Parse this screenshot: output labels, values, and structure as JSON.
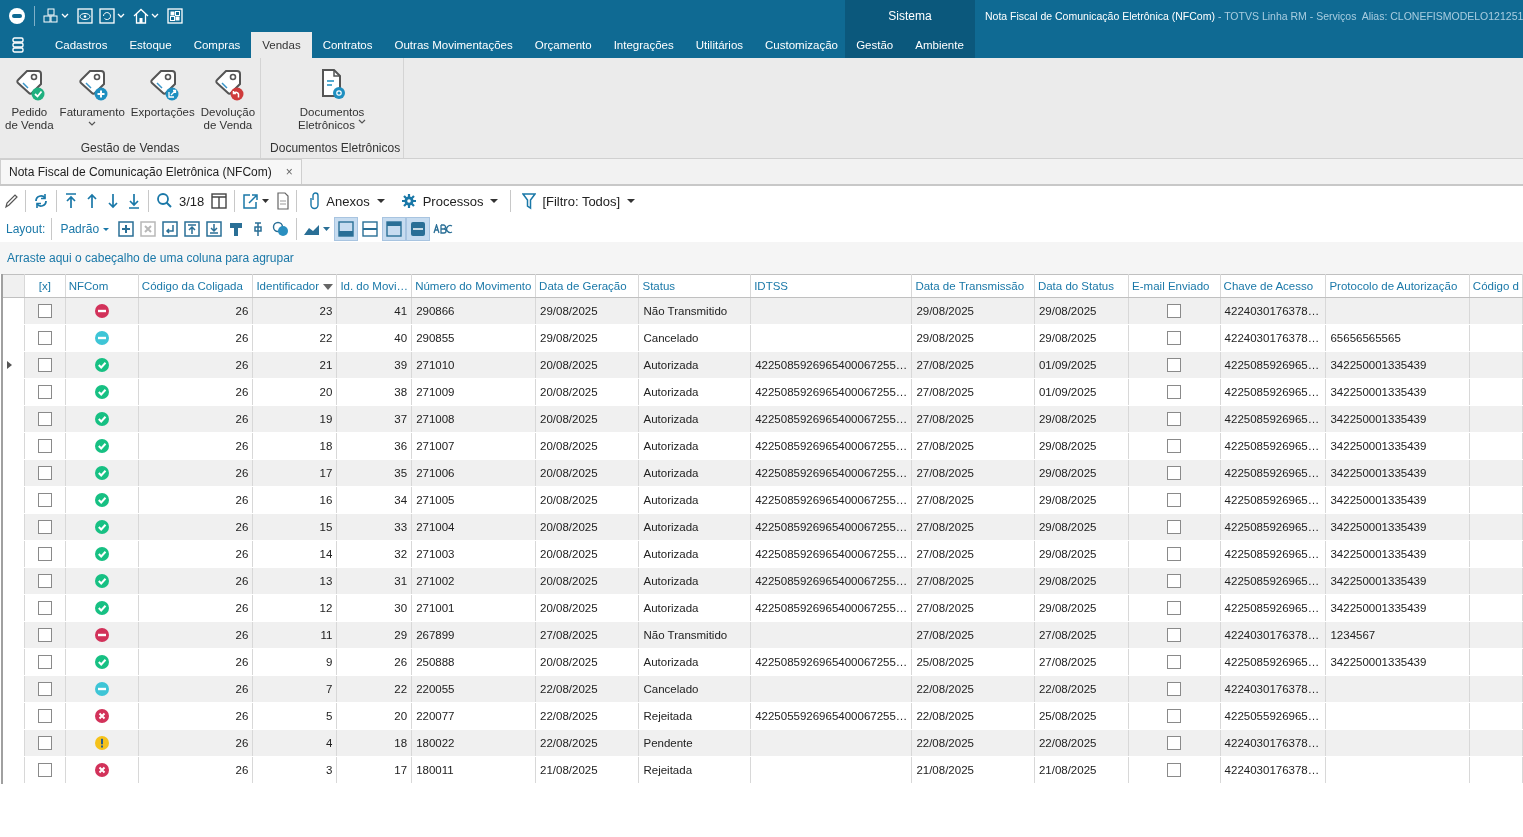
{
  "window": {
    "title": "Nota Fiscal de Comunicação Eletrônica (NFCom)",
    "subtitle": "- TOTVS Linha RM - Serviços  Alias: CLONEFISMODELO121251"
  },
  "menu": {
    "tabs": [
      {
        "label": "Cadastros",
        "selected": false
      },
      {
        "label": "Estoque",
        "selected": false
      },
      {
        "label": "Compras",
        "selected": false
      },
      {
        "label": "Vendas",
        "selected": true
      },
      {
        "label": "Contratos",
        "selected": false
      },
      {
        "label": "Outras Movimentações",
        "selected": false
      },
      {
        "label": "Orçamento",
        "selected": false
      },
      {
        "label": "Integrações",
        "selected": false
      },
      {
        "label": "Utilitários",
        "selected": false
      },
      {
        "label": "Customização",
        "selected": false
      }
    ],
    "context_group": {
      "label": "Sistema",
      "tabs": [
        {
          "label": "Gestão",
          "selected": false
        },
        {
          "label": "Ambiente",
          "selected": false
        }
      ]
    }
  },
  "ribbon": {
    "groups": [
      {
        "label": "Gestão de Vendas",
        "buttons": [
          {
            "lines": [
              "Pedido",
              "de Venda"
            ],
            "kind": "check",
            "dropdown": false
          },
          {
            "lines": [
              "Faturamento"
            ],
            "kind": "plus",
            "dropdown": true
          },
          {
            "lines": [
              "Exportações"
            ],
            "kind": "export",
            "dropdown": false
          },
          {
            "lines": [
              "Devolução",
              "de Venda"
            ],
            "kind": "undo",
            "dropdown": false
          }
        ]
      },
      {
        "label": "Documentos Eletrônicos",
        "buttons": [
          {
            "lines": [
              "Documentos",
              "Eletrônicos"
            ],
            "kind": "document",
            "dropdown": true
          }
        ]
      }
    ]
  },
  "document_tabs": [
    {
      "label": "Nota Fiscal de Comunicação Eletrônica (NFCom)",
      "close": "×",
      "selected": true
    }
  ],
  "toolbar": {
    "counter": "3/18",
    "menus": [
      {
        "label": "Anexos"
      },
      {
        "label": "Processos"
      },
      {
        "label": "[Filtro: Todos]"
      }
    ]
  },
  "layout_bar": {
    "label": "Layout:",
    "preset": "Padrão",
    "tools": [
      {
        "disabled": false
      },
      {
        "disabled": true
      },
      {
        "disabled": false
      },
      {
        "disabled": false
      },
      {
        "disabled": false
      },
      {
        "disabled": false
      },
      {
        "disabled": false
      }
    ],
    "toggles": [
      {
        "pressed": true
      },
      {
        "pressed": false
      },
      {
        "pressed": true
      },
      {
        "pressed": true
      }
    ]
  },
  "group_panel": {
    "hint": "Arraste aqui o cabeçalho de uma coluna para agrupar"
  },
  "table": {
    "columns": [
      {
        "label": "[x]"
      },
      {
        "label": "NFCom"
      },
      {
        "label": "Código da Coligada"
      },
      {
        "label": "Identificador",
        "sorted_descending": true
      },
      {
        "label": "Id. do Movi…"
      },
      {
        "label": "Número do Movimento"
      },
      {
        "label": "Data de Geração"
      },
      {
        "label": "Status"
      },
      {
        "label": "IDTSS"
      },
      {
        "label": "Data de Transmissão"
      },
      {
        "label": "Data do Status"
      },
      {
        "label": "E-mail Enviado"
      },
      {
        "label": "Chave de Acesso"
      },
      {
        "label": "Protocolo de Autorização"
      },
      {
        "label": "Código d"
      }
    ],
    "rows": [
      {
        "current": false,
        "checked": false,
        "kind": "nao_transmitido",
        "email_sent": false,
        "cells": [
          "",
          "",
          "26",
          "23",
          "41",
          "290866",
          "29/08/2025",
          "Não Transmitido",
          "",
          "29/08/2025",
          "29/08/2025",
          "",
          "4224030176378…",
          "",
          ""
        ]
      },
      {
        "current": false,
        "checked": false,
        "kind": "cancelado",
        "email_sent": false,
        "cells": [
          "",
          "",
          "26",
          "22",
          "40",
          "290855",
          "29/08/2025",
          "Cancelado",
          "",
          "29/08/2025",
          "29/08/2025",
          "",
          "4224030176378…",
          "65656565565",
          ""
        ]
      },
      {
        "current": true,
        "checked": false,
        "kind": "autorizada",
        "email_sent": false,
        "cells": [
          "",
          "",
          "26",
          "21",
          "39",
          "271010",
          "20/08/2025",
          "Autorizada",
          "4225085926965400067255…",
          "27/08/2025",
          "01/09/2025",
          "",
          "4225085926965…",
          "342250001335439",
          ""
        ]
      },
      {
        "current": false,
        "checked": false,
        "kind": "autorizada",
        "email_sent": false,
        "cells": [
          "",
          "",
          "26",
          "20",
          "38",
          "271009",
          "20/08/2025",
          "Autorizada",
          "4225085926965400067255…",
          "27/08/2025",
          "01/09/2025",
          "",
          "4225085926965…",
          "342250001335439",
          ""
        ]
      },
      {
        "current": false,
        "checked": false,
        "kind": "autorizada",
        "email_sent": false,
        "cells": [
          "",
          "",
          "26",
          "19",
          "37",
          "271008",
          "20/08/2025",
          "Autorizada",
          "4225085926965400067255…",
          "27/08/2025",
          "29/08/2025",
          "",
          "4225085926965…",
          "342250001335439",
          ""
        ]
      },
      {
        "current": false,
        "checked": false,
        "kind": "autorizada",
        "email_sent": false,
        "cells": [
          "",
          "",
          "26",
          "18",
          "36",
          "271007",
          "20/08/2025",
          "Autorizada",
          "4225085926965400067255…",
          "27/08/2025",
          "29/08/2025",
          "",
          "4225085926965…",
          "342250001335439",
          ""
        ]
      },
      {
        "current": false,
        "checked": false,
        "kind": "autorizada",
        "email_sent": false,
        "cells": [
          "",
          "",
          "26",
          "17",
          "35",
          "271006",
          "20/08/2025",
          "Autorizada",
          "4225085926965400067255…",
          "27/08/2025",
          "29/08/2025",
          "",
          "4225085926965…",
          "342250001335439",
          ""
        ]
      },
      {
        "current": false,
        "checked": false,
        "kind": "autorizada",
        "email_sent": false,
        "cells": [
          "",
          "",
          "26",
          "16",
          "34",
          "271005",
          "20/08/2025",
          "Autorizada",
          "4225085926965400067255…",
          "27/08/2025",
          "29/08/2025",
          "",
          "4225085926965…",
          "342250001335439",
          ""
        ]
      },
      {
        "current": false,
        "checked": false,
        "kind": "autorizada",
        "email_sent": false,
        "cells": [
          "",
          "",
          "26",
          "15",
          "33",
          "271004",
          "20/08/2025",
          "Autorizada",
          "4225085926965400067255…",
          "27/08/2025",
          "29/08/2025",
          "",
          "4225085926965…",
          "342250001335439",
          ""
        ]
      },
      {
        "current": false,
        "checked": false,
        "kind": "autorizada",
        "email_sent": false,
        "cells": [
          "",
          "",
          "26",
          "14",
          "32",
          "271003",
          "20/08/2025",
          "Autorizada",
          "4225085926965400067255…",
          "27/08/2025",
          "29/08/2025",
          "",
          "4225085926965…",
          "342250001335439",
          ""
        ]
      },
      {
        "current": false,
        "checked": false,
        "kind": "autorizada",
        "email_sent": false,
        "cells": [
          "",
          "",
          "26",
          "13",
          "31",
          "271002",
          "20/08/2025",
          "Autorizada",
          "4225085926965400067255…",
          "27/08/2025",
          "29/08/2025",
          "",
          "4225085926965…",
          "342250001335439",
          ""
        ]
      },
      {
        "current": false,
        "checked": false,
        "kind": "autorizada",
        "email_sent": false,
        "cells": [
          "",
          "",
          "26",
          "12",
          "30",
          "271001",
          "20/08/2025",
          "Autorizada",
          "4225085926965400067255…",
          "27/08/2025",
          "29/08/2025",
          "",
          "4225085926965…",
          "342250001335439",
          ""
        ]
      },
      {
        "current": false,
        "checked": false,
        "kind": "nao_transmitido",
        "email_sent": false,
        "cells": [
          "",
          "",
          "26",
          "11",
          "29",
          "267899",
          "27/08/2025",
          "Não Transmitido",
          "",
          "27/08/2025",
          "27/08/2025",
          "",
          "4224030176378…",
          "1234567",
          ""
        ]
      },
      {
        "current": false,
        "checked": false,
        "kind": "autorizada",
        "email_sent": false,
        "cells": [
          "",
          "",
          "26",
          "9",
          "26",
          "250888",
          "20/08/2025",
          "Autorizada",
          "4225085926965400067255…",
          "25/08/2025",
          "27/08/2025",
          "",
          "4225085926965…",
          "342250001335439",
          ""
        ]
      },
      {
        "current": false,
        "checked": false,
        "kind": "cancelado",
        "email_sent": false,
        "cells": [
          "",
          "",
          "26",
          "7",
          "22",
          "220055",
          "22/08/2025",
          "Cancelado",
          "",
          "22/08/2025",
          "22/08/2025",
          "",
          "4224030176378…",
          "",
          ""
        ]
      },
      {
        "current": false,
        "checked": false,
        "kind": "rejeitada",
        "email_sent": false,
        "cells": [
          "",
          "",
          "26",
          "5",
          "20",
          "220077",
          "22/08/2025",
          "Rejeitada",
          "4225055926965400067255…",
          "22/08/2025",
          "25/08/2025",
          "",
          "4225055926965…",
          "",
          ""
        ]
      },
      {
        "current": false,
        "checked": false,
        "kind": "pendente",
        "email_sent": false,
        "cells": [
          "",
          "",
          "26",
          "4",
          "18",
          "180022",
          "22/08/2025",
          "Pendente",
          "",
          "22/08/2025",
          "22/08/2025",
          "",
          "4224030176378…",
          "",
          ""
        ]
      },
      {
        "current": false,
        "checked": false,
        "kind": "rejeitada",
        "email_sent": false,
        "cells": [
          "",
          "",
          "26",
          "3",
          "17",
          "180011",
          "21/08/2025",
          "Rejeitada",
          "",
          "21/08/2025",
          "21/08/2025",
          "",
          "4224030176378…",
          "",
          ""
        ]
      }
    ]
  }
}
